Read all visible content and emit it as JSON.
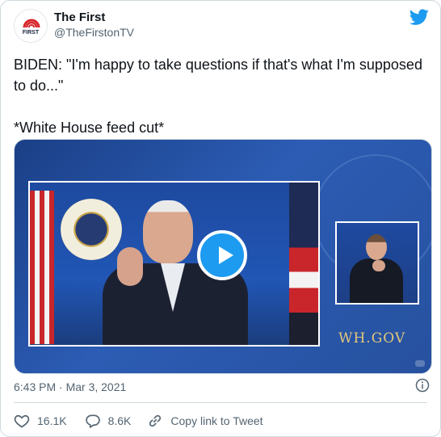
{
  "author": {
    "name": "The First",
    "handle": "@TheFirstonTV",
    "avatar_text": "FIRST"
  },
  "tweet": {
    "line1": "BIDEN: \"I'm happy to take questions if that's what I'm supposed to do...\"",
    "line2": "*White House feed cut*"
  },
  "media": {
    "watermark": "WH.GOV",
    "play_icon": "play-icon"
  },
  "meta": {
    "timestamp": "6:43 PM · Mar 3, 2021"
  },
  "actions": {
    "likes": "16.1K",
    "replies": "8.6K",
    "copy_link": "Copy link to Tweet"
  },
  "colors": {
    "accent": "#1d9bf0",
    "text": "#0f1419",
    "secondary": "#536471",
    "border": "#cfd9de"
  }
}
